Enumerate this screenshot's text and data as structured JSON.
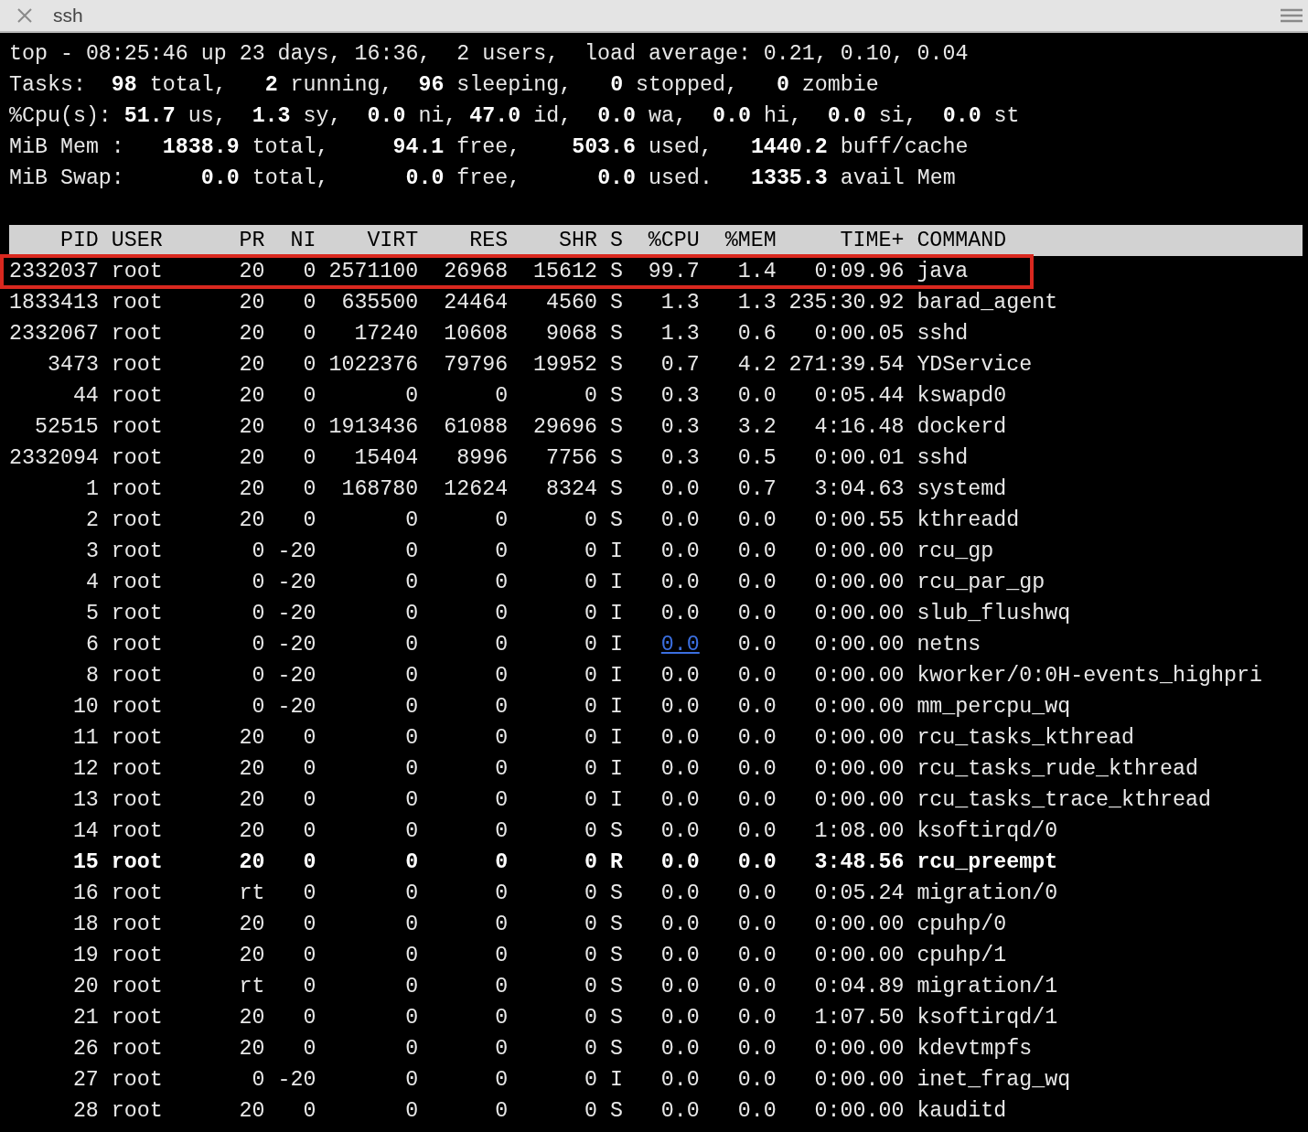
{
  "window": {
    "title": "ssh"
  },
  "summary": [
    "top - 08:25:46 up 23 days, 16:36,  2 users,  load average: 0.21, 0.10, 0.04",
    "Tasks:  **98** total,   **2** running,  **96** sleeping,   **0** stopped,   **0** zombie",
    "%Cpu(s): **51.7** us,  **1.3** sy,  **0.0** ni, **47.0** id,  **0.0** wa,  **0.0** hi,  **0.0** si,  **0.0** st",
    "MiB Mem :   **1838.9** total,     **94.1** free,    **503.6** used,   **1440.2** buff/cache",
    "MiB Swap:      **0.0** total,      **0.0** free,      **0.0** used.   **1335.3** avail Mem"
  ],
  "columns": [
    "PID",
    "USER",
    "PR",
    "NI",
    "VIRT",
    "RES",
    "SHR",
    "S",
    "%CPU",
    "%MEM",
    "TIME+",
    "COMMAND"
  ],
  "rows": [
    {
      "cells": [
        "2332037",
        "root",
        "20",
        "0",
        "2571100",
        "26968",
        "15612",
        "S",
        "99.7",
        "1.4",
        "0:09.96",
        "java"
      ],
      "bold": false,
      "outlined": true,
      "cpu_link": false
    },
    {
      "cells": [
        "1833413",
        "root",
        "20",
        "0",
        "635500",
        "24464",
        "4560",
        "S",
        "1.3",
        "1.3",
        "235:30.92",
        "barad_agent"
      ],
      "bold": false,
      "outlined": false,
      "cpu_link": false
    },
    {
      "cells": [
        "2332067",
        "root",
        "20",
        "0",
        "17240",
        "10608",
        "9068",
        "S",
        "1.3",
        "0.6",
        "0:00.05",
        "sshd"
      ],
      "bold": false,
      "outlined": false,
      "cpu_link": false
    },
    {
      "cells": [
        "3473",
        "root",
        "20",
        "0",
        "1022376",
        "79796",
        "19952",
        "S",
        "0.7",
        "4.2",
        "271:39.54",
        "YDService"
      ],
      "bold": false,
      "outlined": false,
      "cpu_link": false
    },
    {
      "cells": [
        "44",
        "root",
        "20",
        "0",
        "0",
        "0",
        "0",
        "S",
        "0.3",
        "0.0",
        "0:05.44",
        "kswapd0"
      ],
      "bold": false,
      "outlined": false,
      "cpu_link": false
    },
    {
      "cells": [
        "52515",
        "root",
        "20",
        "0",
        "1913436",
        "61088",
        "29696",
        "S",
        "0.3",
        "3.2",
        "4:16.48",
        "dockerd"
      ],
      "bold": false,
      "outlined": false,
      "cpu_link": false
    },
    {
      "cells": [
        "2332094",
        "root",
        "20",
        "0",
        "15404",
        "8996",
        "7756",
        "S",
        "0.3",
        "0.5",
        "0:00.01",
        "sshd"
      ],
      "bold": false,
      "outlined": false,
      "cpu_link": false
    },
    {
      "cells": [
        "1",
        "root",
        "20",
        "0",
        "168780",
        "12624",
        "8324",
        "S",
        "0.0",
        "0.7",
        "3:04.63",
        "systemd"
      ],
      "bold": false,
      "outlined": false,
      "cpu_link": false
    },
    {
      "cells": [
        "2",
        "root",
        "20",
        "0",
        "0",
        "0",
        "0",
        "S",
        "0.0",
        "0.0",
        "0:00.55",
        "kthreadd"
      ],
      "bold": false,
      "outlined": false,
      "cpu_link": false
    },
    {
      "cells": [
        "3",
        "root",
        "0",
        "-20",
        "0",
        "0",
        "0",
        "I",
        "0.0",
        "0.0",
        "0:00.00",
        "rcu_gp"
      ],
      "bold": false,
      "outlined": false,
      "cpu_link": false
    },
    {
      "cells": [
        "4",
        "root",
        "0",
        "-20",
        "0",
        "0",
        "0",
        "I",
        "0.0",
        "0.0",
        "0:00.00",
        "rcu_par_gp"
      ],
      "bold": false,
      "outlined": false,
      "cpu_link": false
    },
    {
      "cells": [
        "5",
        "root",
        "0",
        "-20",
        "0",
        "0",
        "0",
        "I",
        "0.0",
        "0.0",
        "0:00.00",
        "slub_flushwq"
      ],
      "bold": false,
      "outlined": false,
      "cpu_link": false
    },
    {
      "cells": [
        "6",
        "root",
        "0",
        "-20",
        "0",
        "0",
        "0",
        "I",
        "0.0",
        "0.0",
        "0:00.00",
        "netns"
      ],
      "bold": false,
      "outlined": false,
      "cpu_link": true
    },
    {
      "cells": [
        "8",
        "root",
        "0",
        "-20",
        "0",
        "0",
        "0",
        "I",
        "0.0",
        "0.0",
        "0:00.00",
        "kworker/0:0H-events_highpri"
      ],
      "bold": false,
      "outlined": false,
      "cpu_link": false
    },
    {
      "cells": [
        "10",
        "root",
        "0",
        "-20",
        "0",
        "0",
        "0",
        "I",
        "0.0",
        "0.0",
        "0:00.00",
        "mm_percpu_wq"
      ],
      "bold": false,
      "outlined": false,
      "cpu_link": false
    },
    {
      "cells": [
        "11",
        "root",
        "20",
        "0",
        "0",
        "0",
        "0",
        "I",
        "0.0",
        "0.0",
        "0:00.00",
        "rcu_tasks_kthread"
      ],
      "bold": false,
      "outlined": false,
      "cpu_link": false
    },
    {
      "cells": [
        "12",
        "root",
        "20",
        "0",
        "0",
        "0",
        "0",
        "I",
        "0.0",
        "0.0",
        "0:00.00",
        "rcu_tasks_rude_kthread"
      ],
      "bold": false,
      "outlined": false,
      "cpu_link": false
    },
    {
      "cells": [
        "13",
        "root",
        "20",
        "0",
        "0",
        "0",
        "0",
        "I",
        "0.0",
        "0.0",
        "0:00.00",
        "rcu_tasks_trace_kthread"
      ],
      "bold": false,
      "outlined": false,
      "cpu_link": false
    },
    {
      "cells": [
        "14",
        "root",
        "20",
        "0",
        "0",
        "0",
        "0",
        "S",
        "0.0",
        "0.0",
        "1:08.00",
        "ksoftirqd/0"
      ],
      "bold": false,
      "outlined": false,
      "cpu_link": false
    },
    {
      "cells": [
        "15",
        "root",
        "20",
        "0",
        "0",
        "0",
        "0",
        "R",
        "0.0",
        "0.0",
        "3:48.56",
        "rcu_preempt"
      ],
      "bold": true,
      "outlined": false,
      "cpu_link": false
    },
    {
      "cells": [
        "16",
        "root",
        "rt",
        "0",
        "0",
        "0",
        "0",
        "S",
        "0.0",
        "0.0",
        "0:05.24",
        "migration/0"
      ],
      "bold": false,
      "outlined": false,
      "cpu_link": false
    },
    {
      "cells": [
        "18",
        "root",
        "20",
        "0",
        "0",
        "0",
        "0",
        "S",
        "0.0",
        "0.0",
        "0:00.00",
        "cpuhp/0"
      ],
      "bold": false,
      "outlined": false,
      "cpu_link": false
    },
    {
      "cells": [
        "19",
        "root",
        "20",
        "0",
        "0",
        "0",
        "0",
        "S",
        "0.0",
        "0.0",
        "0:00.00",
        "cpuhp/1"
      ],
      "bold": false,
      "outlined": false,
      "cpu_link": false
    },
    {
      "cells": [
        "20",
        "root",
        "rt",
        "0",
        "0",
        "0",
        "0",
        "S",
        "0.0",
        "0.0",
        "0:04.89",
        "migration/1"
      ],
      "bold": false,
      "outlined": false,
      "cpu_link": false
    },
    {
      "cells": [
        "21",
        "root",
        "20",
        "0",
        "0",
        "0",
        "0",
        "S",
        "0.0",
        "0.0",
        "1:07.50",
        "ksoftirqd/1"
      ],
      "bold": false,
      "outlined": false,
      "cpu_link": false
    },
    {
      "cells": [
        "26",
        "root",
        "20",
        "0",
        "0",
        "0",
        "0",
        "S",
        "0.0",
        "0.0",
        "0:00.00",
        "kdevtmpfs"
      ],
      "bold": false,
      "outlined": false,
      "cpu_link": false
    },
    {
      "cells": [
        "27",
        "root",
        "0",
        "-20",
        "0",
        "0",
        "0",
        "I",
        "0.0",
        "0.0",
        "0:00.00",
        "inet_frag_wq"
      ],
      "bold": false,
      "outlined": false,
      "cpu_link": false
    },
    {
      "cells": [
        "28",
        "root",
        "20",
        "0",
        "0",
        "0",
        "0",
        "S",
        "0.0",
        "0.0",
        "0:00.00",
        "kauditd"
      ],
      "bold": false,
      "outlined": false,
      "cpu_link": false
    }
  ]
}
